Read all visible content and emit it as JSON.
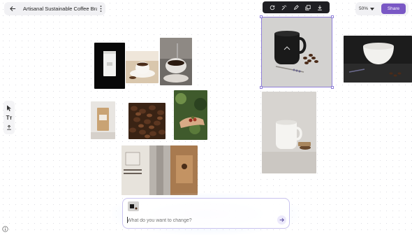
{
  "header": {
    "back_icon": "arrow-left-icon",
    "project_title": "Artisanal Sustainable Coffee Bra",
    "menu_icon": "kebab-menu-icon"
  },
  "image_toolbar": {
    "actions": [
      "refresh-icon",
      "magic-variations-icon",
      "edit-icon",
      "duplicate-icon",
      "download-icon"
    ]
  },
  "zoom": {
    "level": "50%"
  },
  "share": {
    "label": "Share"
  },
  "tools": [
    "select-tool-icon",
    "text-tool-icon",
    "upload-icon"
  ],
  "text_tool": {
    "label": "Tт"
  },
  "prompt": {
    "placeholder": "What do you want to change?"
  },
  "colors": {
    "accent": "#7a58c5",
    "toolbar_bg": "#1f1f23",
    "selection": "#8f7fd9"
  },
  "canvas_items": [
    "coffee-bag-black-background-image",
    "coffee-cup-on-saucer-image",
    "pour-over-coffee-image",
    "coffee-bag-on-table-image",
    "coffee-beans-image",
    "hand-holding-coffee-cherries-image",
    "coffee-packaging-collage-image",
    "black-mug-with-beans-image",
    "white-bowl-dark-background-image",
    "white-mug-with-bag-image"
  ]
}
